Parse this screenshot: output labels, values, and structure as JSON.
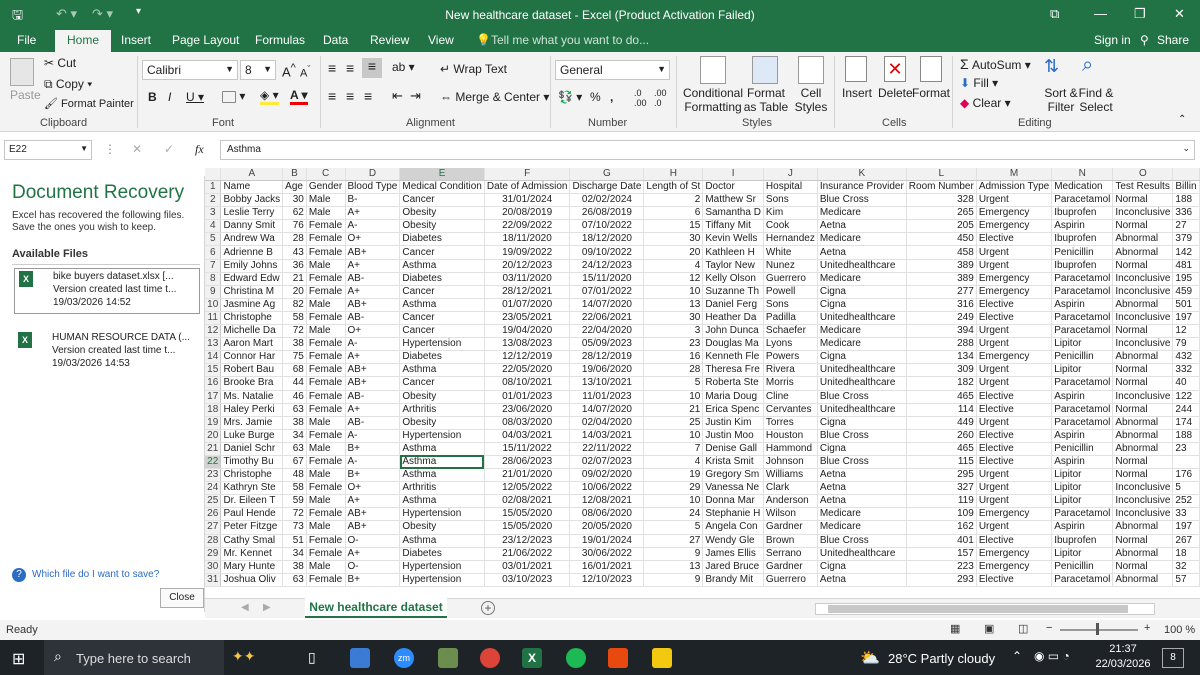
{
  "titlebar": {
    "title": "New healthcare dataset - Excel (Product Activation Failed)"
  },
  "menu": {
    "file": "File",
    "home": "Home",
    "insert": "Insert",
    "page_layout": "Page Layout",
    "formulas": "Formulas",
    "data": "Data",
    "review": "Review",
    "view": "View",
    "tell_me": "Tell me what you want to do...",
    "signin": "Sign in",
    "share": "Share"
  },
  "ribbon": {
    "paste": "Paste",
    "cut": "Cut",
    "copy": "Copy",
    "format_painter": "Format Painter",
    "clipboard": "Clipboard",
    "font_name": "Calibri",
    "font_size": "8",
    "font": "Font",
    "wrap_text": "Wrap Text",
    "merge_center": "Merge & Center",
    "alignment": "Alignment",
    "number_format": "General",
    "number": "Number",
    "conditional_formatting": "Conditional Formatting",
    "format_as_table": "Format as Table",
    "cell_styles": "Cell Styles",
    "styles": "Styles",
    "insert": "Insert",
    "delete": "Delete",
    "format": "Format",
    "cells": "Cells",
    "autosum": "AutoSum",
    "fill": "Fill",
    "clear": "Clear",
    "sort_filter": "Sort & Filter",
    "find_select": "Find & Select",
    "editing": "Editing"
  },
  "formula_bar": {
    "name_box": "E22",
    "fx": "fx",
    "value": "Asthma"
  },
  "recovery": {
    "title": "Document Recovery",
    "desc": "Excel has recovered the following files. Save the ones you wish to keep.",
    "available": "Available Files",
    "files": [
      {
        "name": "bike buyers dataset.xlsx [...",
        "version": "Version created last time t...",
        "date": "19/03/2026 14:52"
      },
      {
        "name": "HUMAN RESOURCE DATA (...",
        "version": "Version created last time t...",
        "date": "19/03/2026 14:53"
      }
    ],
    "help": "Which file do I want to save?",
    "close": "Close"
  },
  "columns": [
    "A",
    "B",
    "C",
    "D",
    "E",
    "F",
    "G",
    "H",
    "I",
    "J",
    "K",
    "L",
    "M",
    "N",
    "O"
  ],
  "headers": [
    "Name",
    "Age",
    "Gender",
    "Blood Type",
    "Medical Condition",
    "Date of Admission",
    "Discharge Date",
    "Length of St",
    "Doctor",
    "Hospital",
    "Insurance Provider",
    "Room Number",
    "Admission Type",
    "Medication",
    "Test Results",
    "Billin"
  ],
  "rows": [
    [
      "Bobby Jacks",
      "30",
      "Male",
      "B-",
      "Cancer",
      "31/01/2024",
      "02/02/2024",
      "2",
      "Matthew Sr",
      "Sons",
      "Blue Cross",
      "328",
      "Urgent",
      "Paracetamol",
      "Normal",
      "188"
    ],
    [
      "Leslie Terry",
      "62",
      "Male",
      "A+",
      "Obesity",
      "20/08/2019",
      "26/08/2019",
      "6",
      "Samantha D",
      "Kim",
      "Medicare",
      "265",
      "Emergency",
      "Ibuprofen",
      "Inconclusive",
      "336"
    ],
    [
      "Danny Smit",
      "76",
      "Female",
      "A-",
      "Obesity",
      "22/09/2022",
      "07/10/2022",
      "15",
      "Tiffany Mit",
      "Cook",
      "Aetna",
      "205",
      "Emergency",
      "Aspirin",
      "Normal",
      "27"
    ],
    [
      "Andrew Wa",
      "28",
      "Female",
      "O+",
      "Diabetes",
      "18/11/2020",
      "18/12/2020",
      "30",
      "Kevin Wells",
      "Hernandez",
      "Medicare",
      "450",
      "Elective",
      "Ibuprofen",
      "Abnormal",
      "379"
    ],
    [
      "Adrienne B",
      "43",
      "Female",
      "AB+",
      "Cancer",
      "19/09/2022",
      "09/10/2022",
      "20",
      "Kathleen H",
      "White",
      "Aetna",
      "458",
      "Urgent",
      "Penicillin",
      "Abnormal",
      "142"
    ],
    [
      "Emily Johns",
      "36",
      "Male",
      "A+",
      "Asthma",
      "20/12/2023",
      "24/12/2023",
      "4",
      "Taylor New",
      "Nunez",
      "Unitedhealthcare",
      "389",
      "Urgent",
      "Ibuprofen",
      "Normal",
      "481"
    ],
    [
      "Edward Edw",
      "21",
      "Female",
      "AB-",
      "Diabetes",
      "03/11/2020",
      "15/11/2020",
      "12",
      "Kelly Olson",
      "Guerrero",
      "Medicare",
      "389",
      "Emergency",
      "Paracetamol",
      "Inconclusive",
      "195"
    ],
    [
      "Christina M",
      "20",
      "Female",
      "A+",
      "Cancer",
      "28/12/2021",
      "07/01/2022",
      "10",
      "Suzanne Th",
      "Powell",
      "Cigna",
      "277",
      "Emergency",
      "Paracetamol",
      "Inconclusive",
      "459"
    ],
    [
      "Jasmine Ag",
      "82",
      "Male",
      "AB+",
      "Asthma",
      "01/07/2020",
      "14/07/2020",
      "13",
      "Daniel Ferg",
      "Sons",
      "Cigna",
      "316",
      "Elective",
      "Aspirin",
      "Abnormal",
      "501"
    ],
    [
      "Christophe",
      "58",
      "Female",
      "AB-",
      "Cancer",
      "23/05/2021",
      "22/06/2021",
      "30",
      "Heather Da",
      "Padilla",
      "Unitedhealthcare",
      "249",
      "Elective",
      "Paracetamol",
      "Inconclusive",
      "197"
    ],
    [
      "Michelle Da",
      "72",
      "Male",
      "O+",
      "Cancer",
      "19/04/2020",
      "22/04/2020",
      "3",
      "John Dunca",
      "Schaefer",
      "Medicare",
      "394",
      "Urgent",
      "Paracetamol",
      "Normal",
      "12"
    ],
    [
      "Aaron Mart",
      "38",
      "Female",
      "A-",
      "Hypertension",
      "13/08/2023",
      "05/09/2023",
      "23",
      "Douglas Ma",
      "Lyons",
      "Medicare",
      "288",
      "Urgent",
      "Lipitor",
      "Inconclusive",
      "79"
    ],
    [
      "Connor Har",
      "75",
      "Female",
      "A+",
      "Diabetes",
      "12/12/2019",
      "28/12/2019",
      "16",
      "Kenneth Fle",
      "Powers",
      "Cigna",
      "134",
      "Emergency",
      "Penicillin",
      "Abnormal",
      "432"
    ],
    [
      "Robert Bau",
      "68",
      "Female",
      "AB+",
      "Asthma",
      "22/05/2020",
      "19/06/2020",
      "28",
      "Theresa Fre",
      "Rivera",
      "Unitedhealthcare",
      "309",
      "Urgent",
      "Lipitor",
      "Normal",
      "332"
    ],
    [
      "Brooke Bra",
      "44",
      "Female",
      "AB+",
      "Cancer",
      "08/10/2021",
      "13/10/2021",
      "5",
      "Roberta Ste",
      "Morris",
      "Unitedhealthcare",
      "182",
      "Urgent",
      "Paracetamol",
      "Normal",
      "40"
    ],
    [
      "Ms. Natalie",
      "46",
      "Female",
      "AB-",
      "Obesity",
      "01/01/2023",
      "11/01/2023",
      "10",
      "Maria Doug",
      "Cline",
      "Blue Cross",
      "465",
      "Elective",
      "Aspirin",
      "Inconclusive",
      "122"
    ],
    [
      "Haley Perki",
      "63",
      "Female",
      "A+",
      "Arthritis",
      "23/06/2020",
      "14/07/2020",
      "21",
      "Erica Spenc",
      "Cervantes",
      "Unitedhealthcare",
      "114",
      "Elective",
      "Paracetamol",
      "Normal",
      "244"
    ],
    [
      "Mrs. Jamie",
      "38",
      "Male",
      "AB-",
      "Obesity",
      "08/03/2020",
      "02/04/2020",
      "25",
      "Justin Kim",
      "Torres",
      "Cigna",
      "449",
      "Urgent",
      "Paracetamol",
      "Abnormal",
      "174"
    ],
    [
      "Luke Burge",
      "34",
      "Female",
      "A-",
      "Hypertension",
      "04/03/2021",
      "14/03/2021",
      "10",
      "Justin Moo",
      "Houston",
      "Blue Cross",
      "260",
      "Elective",
      "Aspirin",
      "Abnormal",
      "188"
    ],
    [
      "Daniel Schr",
      "63",
      "Male",
      "B+",
      "Asthma",
      "15/11/2022",
      "22/11/2022",
      "7",
      "Denise Gall",
      "Hammond",
      "Cigna",
      "465",
      "Elective",
      "Penicillin",
      "Abnormal",
      "23"
    ],
    [
      "Timothy Bu",
      "67",
      "Female",
      "A-",
      "Asthma",
      "28/06/2023",
      "02/07/2023",
      "4",
      "Krista Smit",
      "Johnson",
      "Blue Cross",
      "115",
      "Elective",
      "Aspirin",
      "Normal",
      ""
    ],
    [
      "Christophe",
      "48",
      "Male",
      "B+",
      "Asthma",
      "21/01/2020",
      "09/02/2020",
      "19",
      "Gregory Sm",
      "Williams",
      "Aetna",
      "295",
      "Urgent",
      "Lipitor",
      "Normal",
      "176"
    ],
    [
      "Kathryn Ste",
      "58",
      "Female",
      "O+",
      "Arthritis",
      "12/05/2022",
      "10/06/2022",
      "29",
      "Vanessa Ne",
      "Clark",
      "Aetna",
      "327",
      "Urgent",
      "Lipitor",
      "Inconclusive",
      "5"
    ],
    [
      "Dr. Eileen T",
      "59",
      "Male",
      "A+",
      "Asthma",
      "02/08/2021",
      "12/08/2021",
      "10",
      "Donna Mar",
      "Anderson",
      "Aetna",
      "119",
      "Urgent",
      "Lipitor",
      "Inconclusive",
      "252"
    ],
    [
      "Paul Hende",
      "72",
      "Female",
      "AB+",
      "Hypertension",
      "15/05/2020",
      "08/06/2020",
      "24",
      "Stephanie H",
      "Wilson",
      "Medicare",
      "109",
      "Emergency",
      "Paracetamol",
      "Inconclusive",
      "33"
    ],
    [
      "Peter Fitzge",
      "73",
      "Male",
      "AB+",
      "Obesity",
      "15/05/2020",
      "20/05/2020",
      "5",
      "Angela Con",
      "Gardner",
      "Medicare",
      "162",
      "Urgent",
      "Aspirin",
      "Abnormal",
      "197"
    ],
    [
      "Cathy Smal",
      "51",
      "Female",
      "O-",
      "Asthma",
      "23/12/2023",
      "19/01/2024",
      "27",
      "Wendy Gle",
      "Brown",
      "Blue Cross",
      "401",
      "Elective",
      "Ibuprofen",
      "Normal",
      "267"
    ],
    [
      "Mr. Kennet",
      "34",
      "Female",
      "A+",
      "Diabetes",
      "21/06/2022",
      "30/06/2022",
      "9",
      "James Ellis",
      "Serrano",
      "Unitedhealthcare",
      "157",
      "Emergency",
      "Lipitor",
      "Abnormal",
      "18"
    ],
    [
      "Mary Hunte",
      "38",
      "Male",
      "O-",
      "Hypertension",
      "03/01/2021",
      "16/01/2021",
      "13",
      "Jared Bruce",
      "Gardner",
      "Cigna",
      "223",
      "Emergency",
      "Penicillin",
      "Normal",
      "32"
    ],
    [
      "Joshua Oliv",
      "63",
      "Female",
      "B+",
      "Hypertension",
      "03/10/2023",
      "12/10/2023",
      "9",
      "Brandy Mit",
      "Guerrero",
      "Aetna",
      "293",
      "Elective",
      "Paracetamol",
      "Abnormal",
      "57"
    ]
  ],
  "sheet_tab": "New healthcare dataset",
  "status": {
    "ready": "Ready",
    "zoom": "100 %"
  },
  "taskbar": {
    "search": "Type here to search",
    "weather": "28°C  Partly cloudy",
    "time": "21:37",
    "date": "22/03/2026",
    "notif": "8"
  }
}
